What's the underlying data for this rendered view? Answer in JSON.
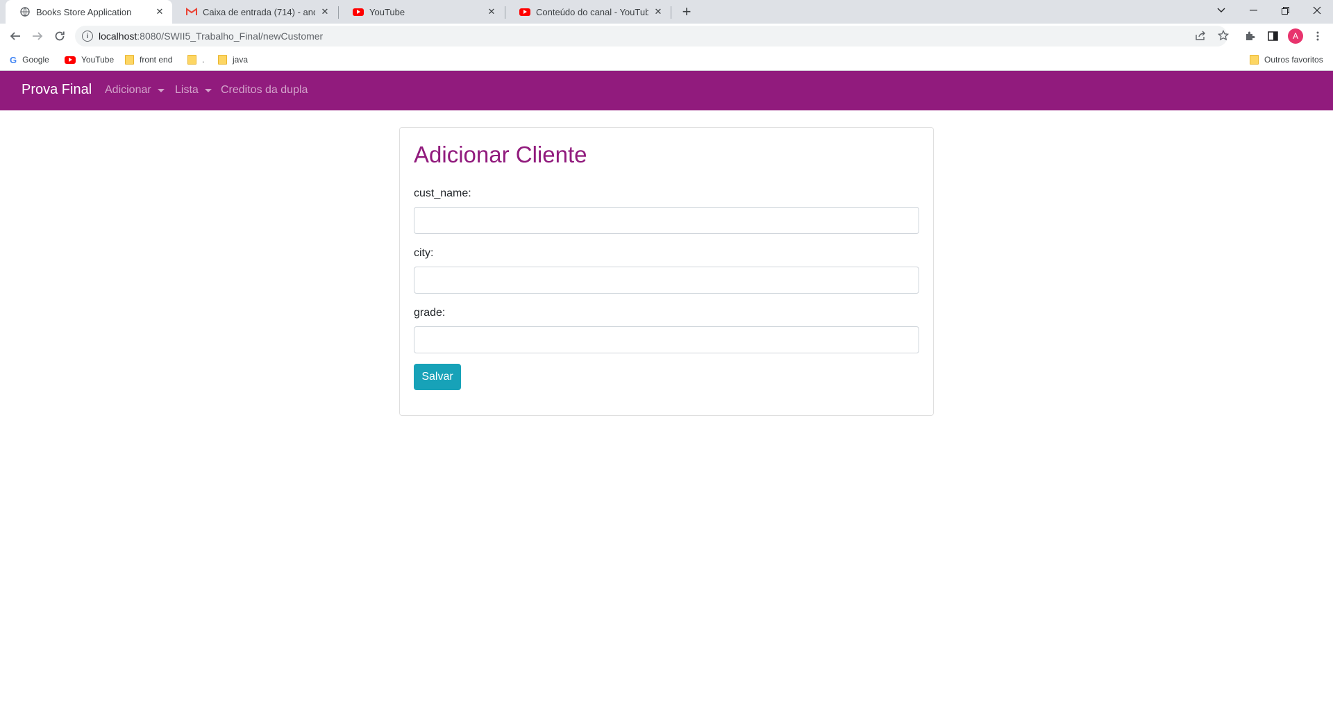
{
  "browser": {
    "tabs": [
      {
        "title": "Books Store Application",
        "icon": "globe-icon",
        "active": true
      },
      {
        "title": "Caixa de entrada (714) - andreza",
        "icon": "gmail-icon",
        "active": false
      },
      {
        "title": "YouTube",
        "icon": "youtube-icon",
        "active": false
      },
      {
        "title": "Conteúdo do canal - YouTube St",
        "icon": "youtube-studio-icon",
        "active": false
      }
    ],
    "url_host": "localhost",
    "url_path": ":8080/SWII5_Trabalho_Final/newCustomer",
    "avatar_letter": "A",
    "bookmarks": [
      {
        "label": "Google",
        "icon": "google-icon"
      },
      {
        "label": "YouTube",
        "icon": "youtube-icon"
      },
      {
        "label": "front end",
        "icon": "folder-icon"
      },
      {
        "label": ".",
        "icon": "folder-icon"
      },
      {
        "label": "java",
        "icon": "folder-icon"
      }
    ],
    "other_bookmarks": "Outros favoritos"
  },
  "navbar": {
    "brand": "Prova Final",
    "links": [
      {
        "label": "Adicionar",
        "dropdown": true
      },
      {
        "label": "Lista",
        "dropdown": true
      },
      {
        "label": "Creditos da dupla",
        "dropdown": false
      }
    ],
    "color": "#911b7d"
  },
  "form": {
    "title": "Adicionar Cliente",
    "fields": [
      {
        "label": "cust_name:",
        "value": ""
      },
      {
        "label": "city:",
        "value": ""
      },
      {
        "label": "grade:",
        "value": ""
      }
    ],
    "submit_label": "Salvar",
    "submit_color": "#17a2b8"
  }
}
